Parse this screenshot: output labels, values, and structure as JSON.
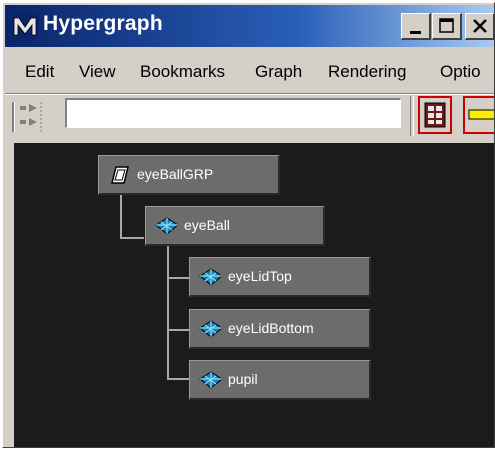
{
  "window": {
    "title": "Hypergraph"
  },
  "menu": {
    "items": [
      "Edit",
      "View",
      "Bookmarks",
      "Graph",
      "Rendering",
      "Optio"
    ]
  },
  "toolbar": {
    "search_value": ""
  },
  "graph": {
    "nodes": [
      {
        "label": "eyeBallGRP",
        "type": "transform-icon"
      },
      {
        "label": "eyeBall",
        "type": "nurbs-surface-icon"
      },
      {
        "label": "eyeLidTop",
        "type": "nurbs-surface-icon"
      },
      {
        "label": "eyeLidBottom",
        "type": "nurbs-surface-icon"
      },
      {
        "label": "pupil",
        "type": "nurbs-surface-icon"
      }
    ]
  },
  "colors": {
    "title_bar": "#0a246a",
    "graph_background": "#1b1b1b",
    "node_fill": "#6c6c6c",
    "accent_red": "#cc0000"
  }
}
